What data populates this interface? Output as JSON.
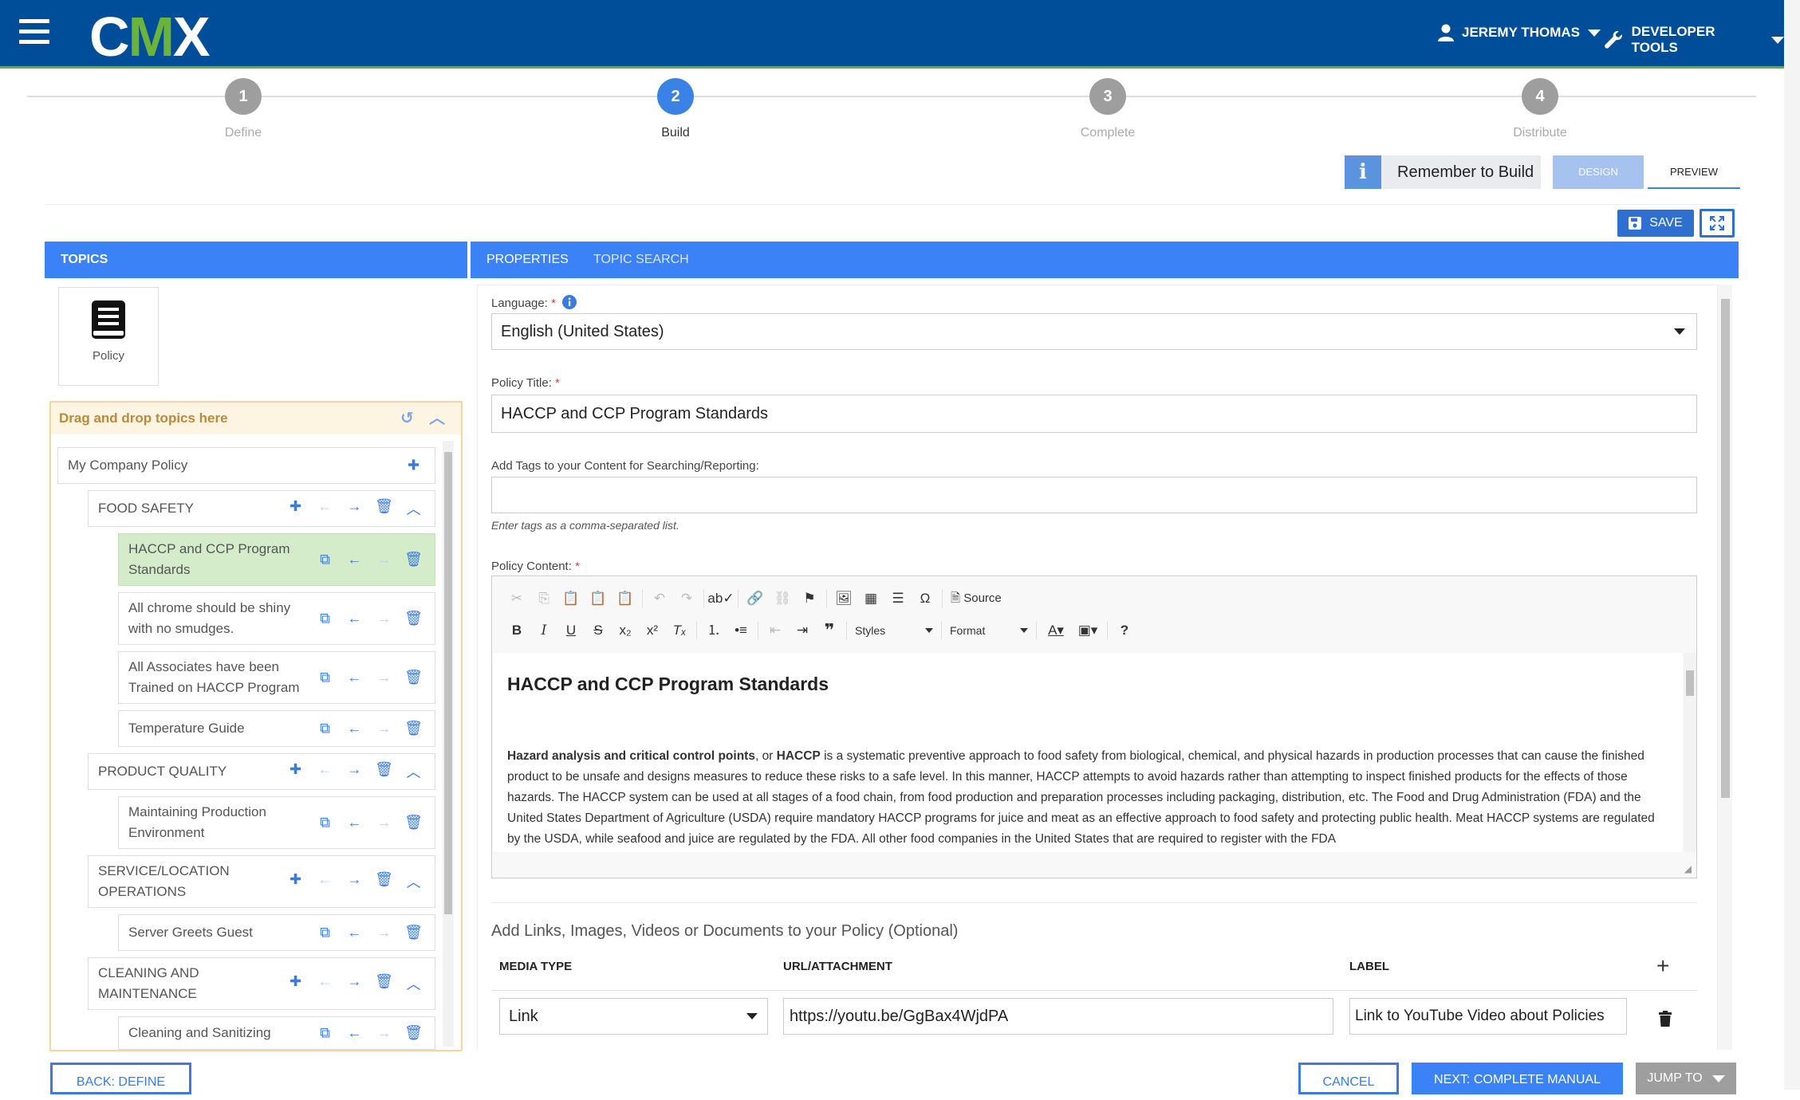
{
  "header": {
    "logo": "CMX",
    "user_label": "JEREMY THOMAS",
    "tools_label": "DEVELOPER TOOLS"
  },
  "stepper": [
    {
      "num": "1",
      "label": "Define"
    },
    {
      "num": "2",
      "label": "Build"
    },
    {
      "num": "3",
      "label": "Complete"
    },
    {
      "num": "4",
      "label": "Distribute"
    }
  ],
  "remember": {
    "text": "Remember to Build"
  },
  "view_tabs": {
    "design": "DESIGN",
    "preview": "PREVIEW"
  },
  "toolbar": {
    "save_label": "SAVE"
  },
  "topics": {
    "header": "TOPICS",
    "tile_label": "Policy",
    "dropzone_label": "Drag and drop topics here",
    "nodes": [
      {
        "label": "My Company Policy"
      },
      {
        "label": "FOOD SAFETY"
      },
      {
        "label": "HACCP and CCP Program Standards"
      },
      {
        "label": "All chrome should be shiny with no smudges."
      },
      {
        "label": "All Associates have been Trained on HACCP Program"
      },
      {
        "label": "Temperature Guide"
      },
      {
        "label": "PRODUCT QUALITY"
      },
      {
        "label": "Maintaining Production Environment"
      },
      {
        "label": "SERVICE/LOCATION OPERATIONS"
      },
      {
        "label": "Server Greets Guest"
      },
      {
        "label": "CLEANING AND MAINTENANCE"
      },
      {
        "label": "Cleaning and Sanitizing"
      }
    ]
  },
  "properties": {
    "tabs": [
      "PROPERTIES",
      "TOPIC SEARCH"
    ],
    "language_label": "Language:",
    "language_value": "English (United States)",
    "title_label": "Policy Title:",
    "title_value": "HACCP and CCP Program Standards",
    "tags_label": "Add Tags to your Content for Searching/Reporting:",
    "tags_value": "",
    "tags_hint": "Enter tags as a comma-separated list.",
    "content_label": "Policy Content:",
    "required_mark": "*"
  },
  "editor": {
    "source_label": "Source",
    "styles_label": "Styles",
    "format_label": "Format",
    "heading": "HACCP and CCP Program Standards",
    "bold_1": "Hazard analysis and critical control points",
    "sep_1": ", or ",
    "bold_2": "HACCP",
    "body": " is a systematic preventive approach to food safety from biological, chemical, and physical hazards in production processes that can cause the finished product to be unsafe and designs measures to reduce these risks to a safe level. In this manner, HACCP attempts to avoid hazards rather than attempting to inspect finished products for the effects of those hazards. The HACCP system can be used at all stages of a food chain, from food production and preparation processes including packaging, distribution, etc. The Food and Drug Administration (FDA) and the United States Department of Agriculture (USDA) require mandatory HACCP programs for juice and meat as an effective approach to food safety and protecting public health. Meat HACCP systems are regulated by the USDA, while seafood and juice are regulated by the FDA. All other food companies in the United States that are required to register with the FDA"
  },
  "media": {
    "title": "Add Links, Images, Videos or Documents to your Policy (Optional)",
    "col_type": "MEDIA TYPE",
    "col_url": "URL/ATTACHMENT",
    "col_label": "LABEL",
    "row": {
      "type": "Link",
      "url": "https://youtu.be/GgBax4WjdPA",
      "label": "Link to YouTube Video about Policies"
    }
  },
  "footer": {
    "back": "BACK: DEFINE",
    "cancel": "CANCEL",
    "next": "NEXT: COMPLETE MANUAL",
    "jump": "JUMP TO"
  },
  "colors": {
    "header_bg": "#004d99",
    "accent": "#3b82f6",
    "logo_green": "#6bb33b",
    "selected_row": "#d4ecc9"
  }
}
